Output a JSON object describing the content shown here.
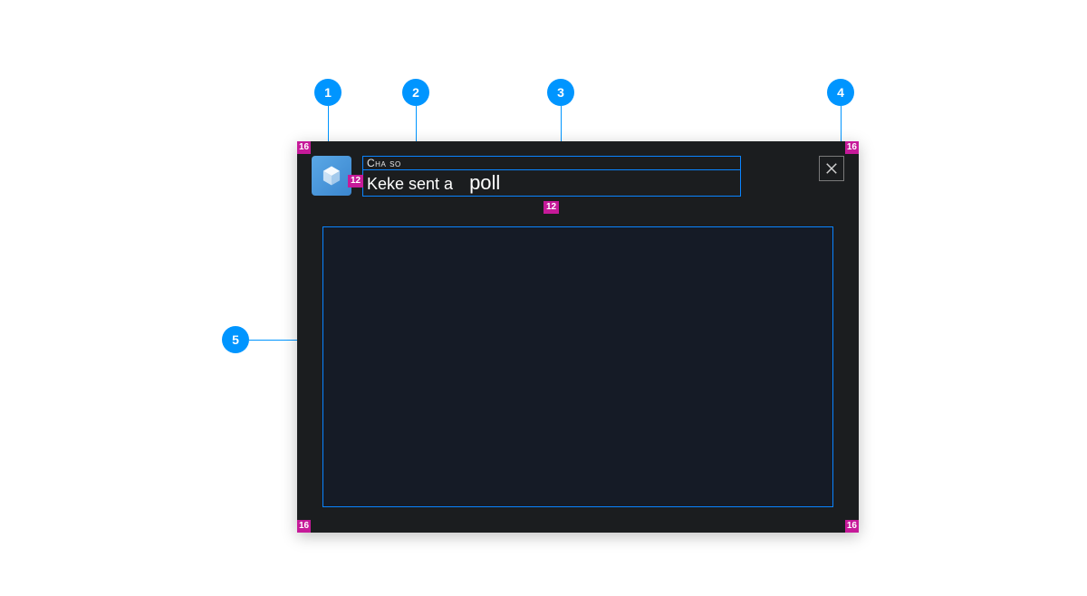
{
  "callouts": {
    "c1": "1",
    "c2": "2",
    "c3": "3",
    "c4": "4",
    "c5": "5"
  },
  "padding": {
    "corner": "16",
    "gap": "12"
  },
  "header": {
    "app_title": "Cна so",
    "message_prefix": "Keke sent a",
    "message_object": "poll"
  },
  "icons": {
    "app": "app-icon",
    "close": "close-icon"
  }
}
